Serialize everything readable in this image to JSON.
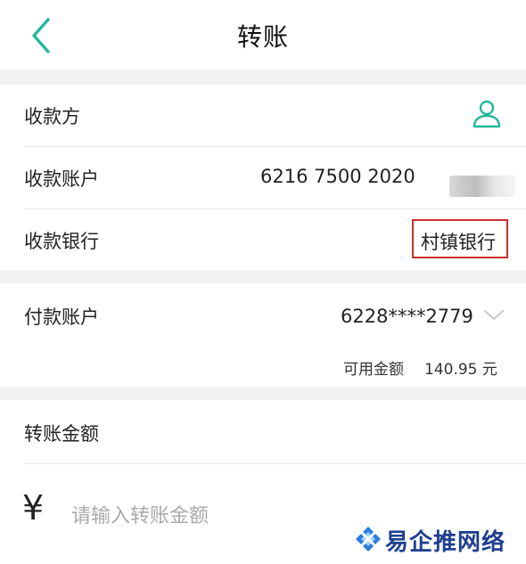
{
  "header": {
    "title": "转账",
    "back_icon": "chevron-left-icon",
    "accent_color": "#1fb89a"
  },
  "payee": {
    "payee_label": "收款方",
    "payee_icon": "person-icon",
    "account_label": "收款账户",
    "account_value": "6216 7500 2020",
    "bank_label": "收款银行",
    "bank_value": "村镇银行"
  },
  "payer": {
    "account_label": "付款账户",
    "account_value": "6228****2779",
    "available_label": "可用金额",
    "available_value": "140.95 元"
  },
  "amount": {
    "label": "转账金额",
    "currency_symbol": "¥",
    "placeholder": "请输入转账金额"
  },
  "watermark": {
    "text": "易企推网络"
  }
}
